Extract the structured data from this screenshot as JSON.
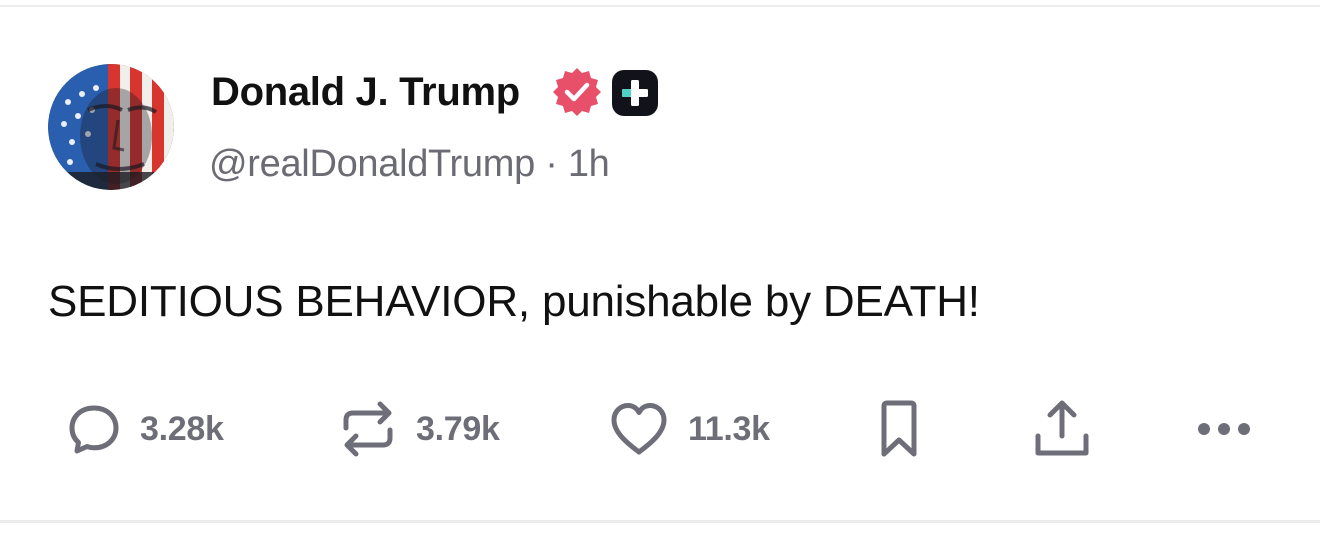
{
  "post": {
    "author": {
      "display_name": "Donald J. Trump",
      "handle": "@realDonaldTrump",
      "separator": "·",
      "time_ago": "1h",
      "verified": true,
      "avatar_icon": "flag-portrait-avatar",
      "badges": [
        "verified-badge-icon",
        "plus-badge-icon"
      ]
    },
    "text": "SEDITIOUS BEHAVIOR, punishable by DEATH!",
    "actions": {
      "reply_count": "3.28k",
      "repost_count": "3.79k",
      "like_count": "11.3k",
      "bookmark_icon": "bookmark-icon",
      "share_icon": "share-icon",
      "more_icon": "more-icon"
    }
  },
  "colors": {
    "text_primary": "#111111",
    "text_secondary": "#6b6b74",
    "action_gray": "#6e6e78",
    "verified_pink": "#e8506a",
    "divider": "#ececec"
  }
}
